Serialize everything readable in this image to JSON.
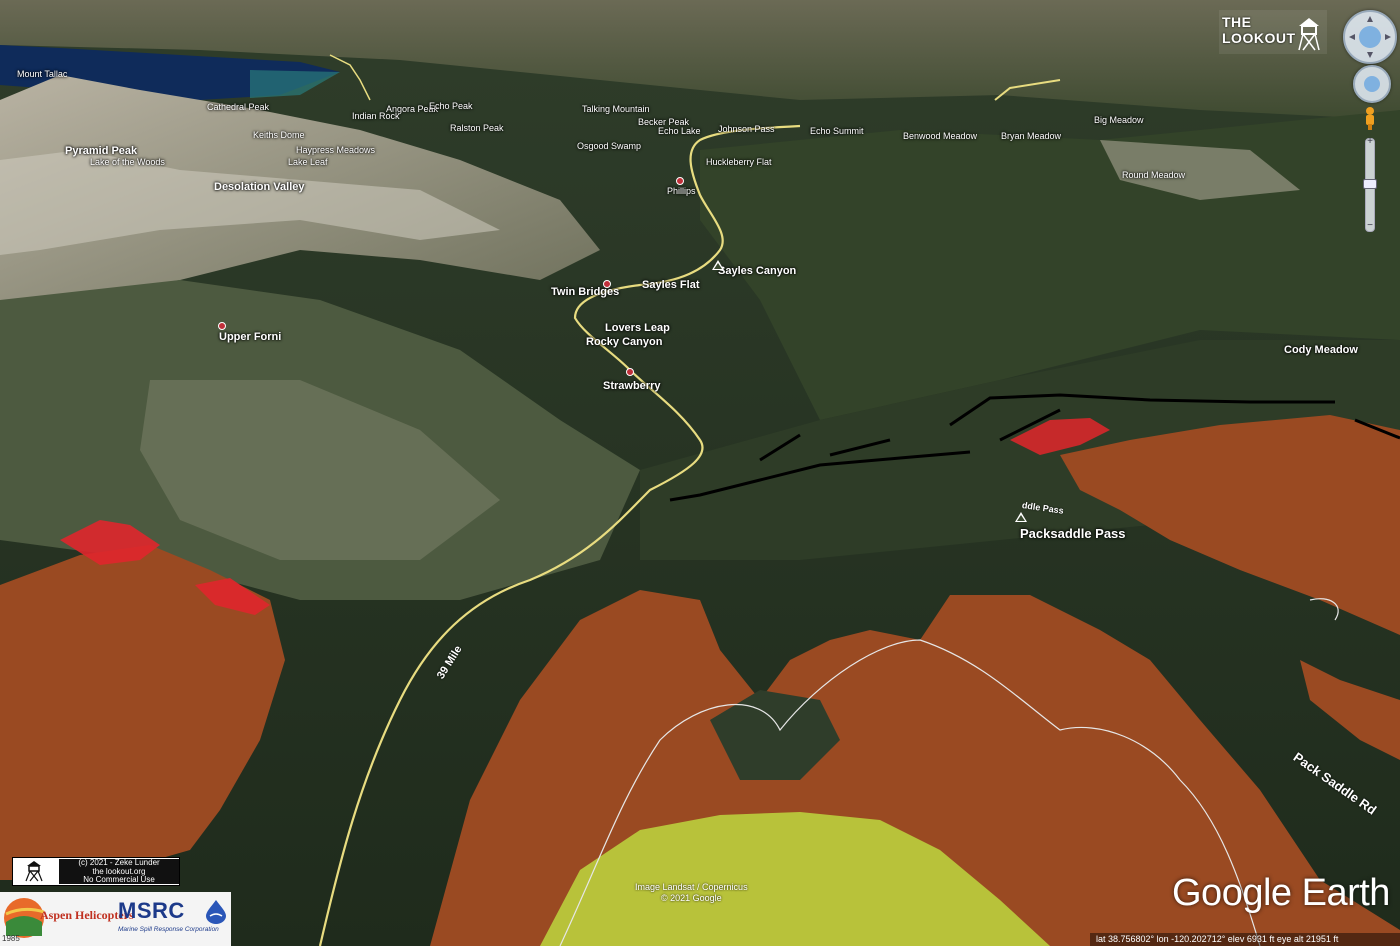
{
  "map": {
    "places": {
      "mount_tallac": "Mount Tallac",
      "cathedral_peak": "Cathedral Peak",
      "angora_peak": "Angora Peak",
      "echo_peak": "Echo Peak",
      "indian_rock": "Indian Rock",
      "keiths_dome": "Keiths Dome",
      "pyramid_peak": "Pyramid Peak",
      "lake_of_the_woods": "Lake of the Woods",
      "haypress_meadows": "Haypress Meadows",
      "lake_leaf": "Lake Leaf",
      "desolation_valley": "Desolation Valley",
      "ralston_peak": "Ralston Peak",
      "talking_mountain": "Talking Mountain",
      "becker_peak": "Becker Peak",
      "echo_lake": "Echo Lake",
      "johnson_pass": "Johnson Pass",
      "echo_summit": "Echo Summit",
      "benwood_meadow": "Benwood Meadow",
      "bryan_meadow": "Bryan Meadow",
      "big_meadow": "Big Meadow",
      "huckleberry_flat": "Huckleberry Flat",
      "osgood_swamp": "Osgood Swamp",
      "round_meadow": "Round Meadow",
      "phillips": "Phillips",
      "sayles_canyon": "Sayles Canyon",
      "sayles_flat": "Sayles Flat",
      "twin_bridges": "Twin Bridges",
      "lovers_leap": "Lovers Leap",
      "rocky_canyon": "Rocky Canyon",
      "upper_forni": "Upper Forni",
      "strawberry": "Strawberry",
      "cody_meadow": "Cody Meadow",
      "packsaddle_pass": "Packsaddle Pass",
      "packsaddle_pass_road": "Pack Saddle Rd",
      "packsaddle_small": "ddle Pass",
      "thirty_nine_mile": "39 Mile"
    },
    "colors": {
      "burn_scar": "#9a4a22",
      "green_unburned": "#b8c23a",
      "active_fire": "#e0262c",
      "dozer_line": "#000000",
      "highway": "#e8dc80",
      "lake": "#0f2b5a"
    }
  },
  "overlay": {
    "lookout_title_line1": "THE",
    "lookout_title_line2": "LOOKOUT",
    "credit_line1": "(c) 2021 - Zeke Lunder",
    "credit_line2": "the lookout.org",
    "credit_line3": "No Commercial Use",
    "logo_aspen": "Aspen Helicopters",
    "logo_aspen_year": "1985",
    "logo_msrc": "MSRC",
    "logo_msrc_sub": "Marine Spill Response Corporation",
    "image_credit_line1": "Image Landsat / Copernicus",
    "image_credit_line2": "© 2021 Google",
    "google_earth": "Google Earth",
    "status": "lat  38.756802°  lon -120.202712°  elev  6931 ft     eye alt  21951 ft"
  }
}
